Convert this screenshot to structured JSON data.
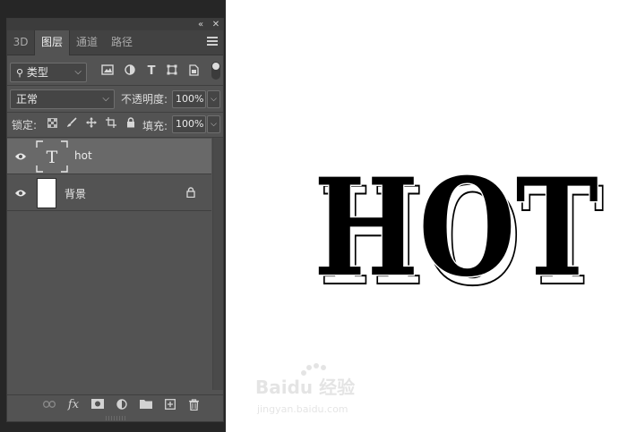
{
  "panel_top": {
    "collapse_icon": "double-chevron-left-icon",
    "close_icon": "close-icon"
  },
  "tabs": [
    {
      "label": "3D",
      "active": false
    },
    {
      "label": "图层",
      "active": true
    },
    {
      "label": "通道",
      "active": false
    },
    {
      "label": "路径",
      "active": false
    }
  ],
  "filter": {
    "type_label": "类型"
  },
  "blend": {
    "mode": "正常",
    "opacity_label": "不透明度:",
    "opacity": "100%"
  },
  "lock": {
    "label": "锁定:",
    "fill_label": "填充:",
    "fill": "100%"
  },
  "layers": [
    {
      "name": "hot",
      "kind": "text",
      "thumb_glyph": "T",
      "selected": true,
      "visible": true
    },
    {
      "name": "背景",
      "kind": "background",
      "selected": false,
      "visible": true,
      "locked": true
    }
  ],
  "bottom_icons": [
    "link-icon",
    "fx-icon",
    "mask-icon",
    "adjustment-icon",
    "folder-icon",
    "new-layer-icon",
    "trash-icon"
  ],
  "canvas": {
    "text": "HOT",
    "text_color": "#000000",
    "shadow_color": "#000000"
  },
  "watermark": {
    "brand": "Baidu 经验",
    "url": "jingyan.baidu.com"
  }
}
